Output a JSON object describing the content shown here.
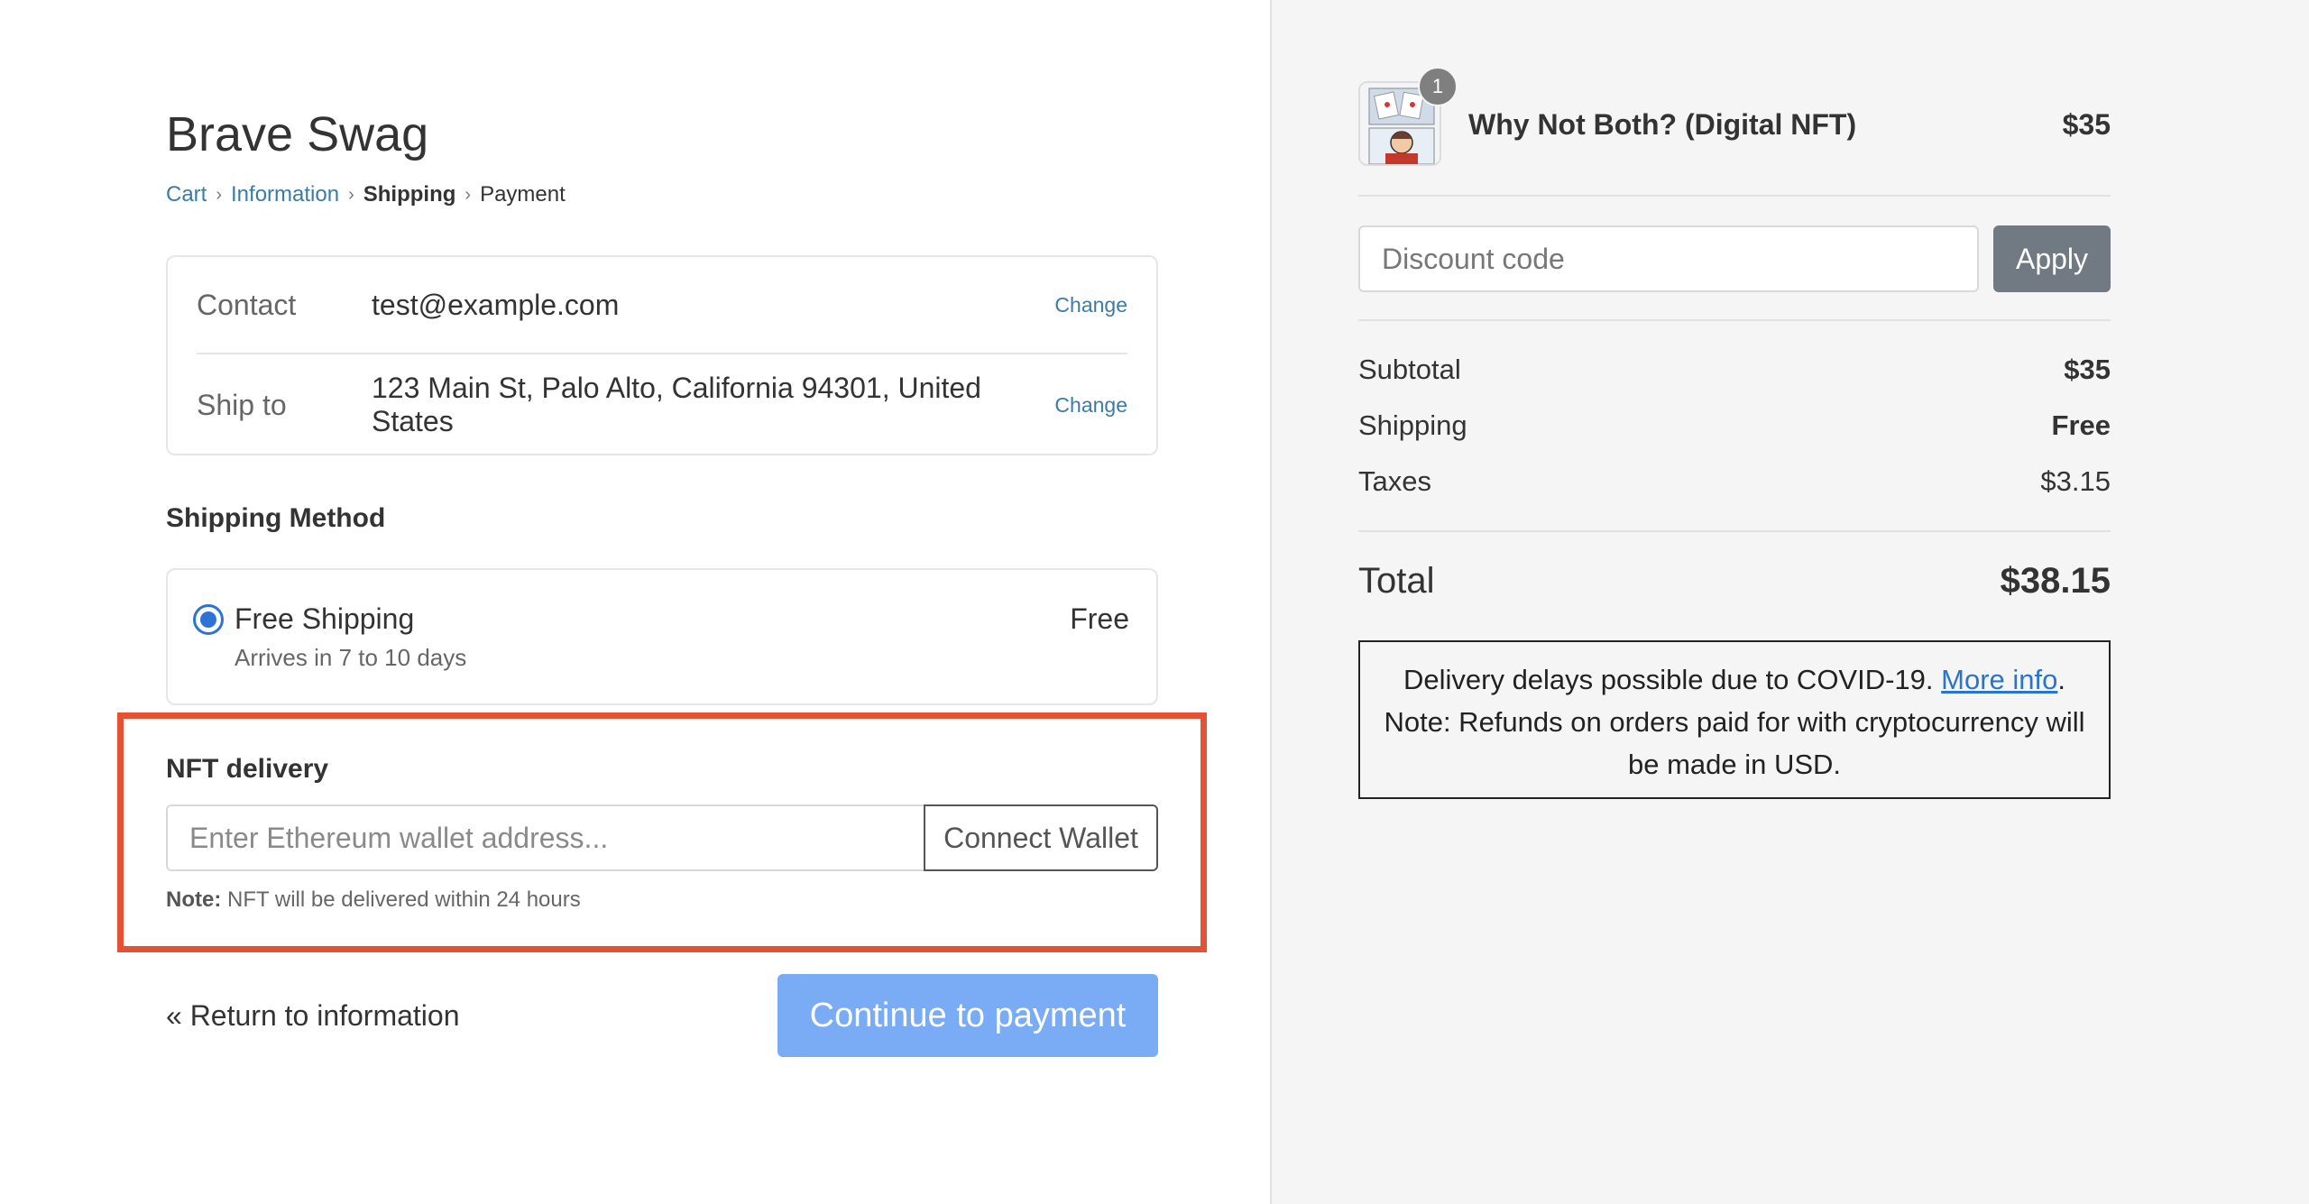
{
  "store": {
    "title": "Brave Swag"
  },
  "breadcrumb": {
    "cart": "Cart",
    "information": "Information",
    "shipping": "Shipping",
    "payment": "Payment",
    "separator": "›"
  },
  "contact": {
    "label": "Contact",
    "value": "test@example.com",
    "change": "Change"
  },
  "ship_to": {
    "label": "Ship to",
    "value": "123 Main St, Palo Alto, California 94301, United States",
    "change": "Change"
  },
  "shipping_method": {
    "title": "Shipping Method",
    "option": {
      "name": "Free Shipping",
      "eta": "Arrives in 7 to 10 days",
      "price": "Free",
      "selected": true
    }
  },
  "nft_delivery": {
    "title": "NFT delivery",
    "wallet_placeholder": "Enter Ethereum wallet address...",
    "connect_label": "Connect Wallet",
    "note_label": "Note:",
    "note_text": " NFT will be delivered within 24 hours"
  },
  "actions": {
    "return_label": "« Return to information",
    "continue_label": "Continue to payment"
  },
  "order": {
    "product": {
      "name": "Why Not Both? (Digital NFT)",
      "price": "$35",
      "quantity": "1"
    },
    "discount_placeholder": "Discount code",
    "apply_label": "Apply",
    "subtotal": {
      "label": "Subtotal",
      "value": "$35"
    },
    "shipping": {
      "label": "Shipping",
      "value": "Free"
    },
    "taxes": {
      "label": "Taxes",
      "value": "$3.15"
    },
    "total": {
      "label": "Total",
      "value": "$38.15"
    }
  },
  "notice": {
    "text1": "Delivery delays possible due to COVID-19. ",
    "more_info": "More info",
    "text2": ". Note: Refunds on orders paid for with cryptocurrency will be made in USD."
  },
  "colors": {
    "link": "#3a7ca5",
    "radio": "#2f72d6",
    "highlight": "#e45233",
    "continue_button": "#7aacf5",
    "apply_button": "#717a82"
  }
}
